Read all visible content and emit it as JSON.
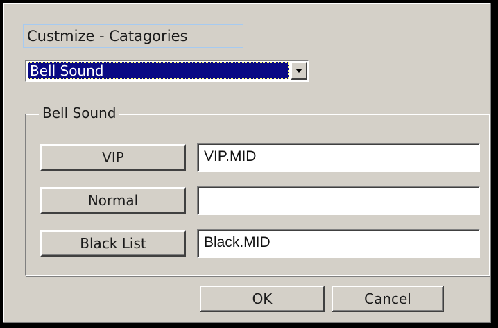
{
  "dialog": {
    "category_label": "Custmize - Catagories",
    "category_select": {
      "selected": "Bell Sound",
      "dropdown_icon": "chevron-down-icon"
    },
    "group": {
      "title": "Bell Sound",
      "rows": [
        {
          "button_label": "VIP",
          "file_value": "VIP.MID"
        },
        {
          "button_label": "Normal",
          "file_value": ""
        },
        {
          "button_label": "Black List",
          "file_value": "Black.MID"
        }
      ]
    },
    "ok_label": "OK",
    "cancel_label": "Cancel"
  },
  "colors": {
    "face": "#d4d0c8",
    "selection": "#0a0a84",
    "label_border": "#a6caf0"
  }
}
